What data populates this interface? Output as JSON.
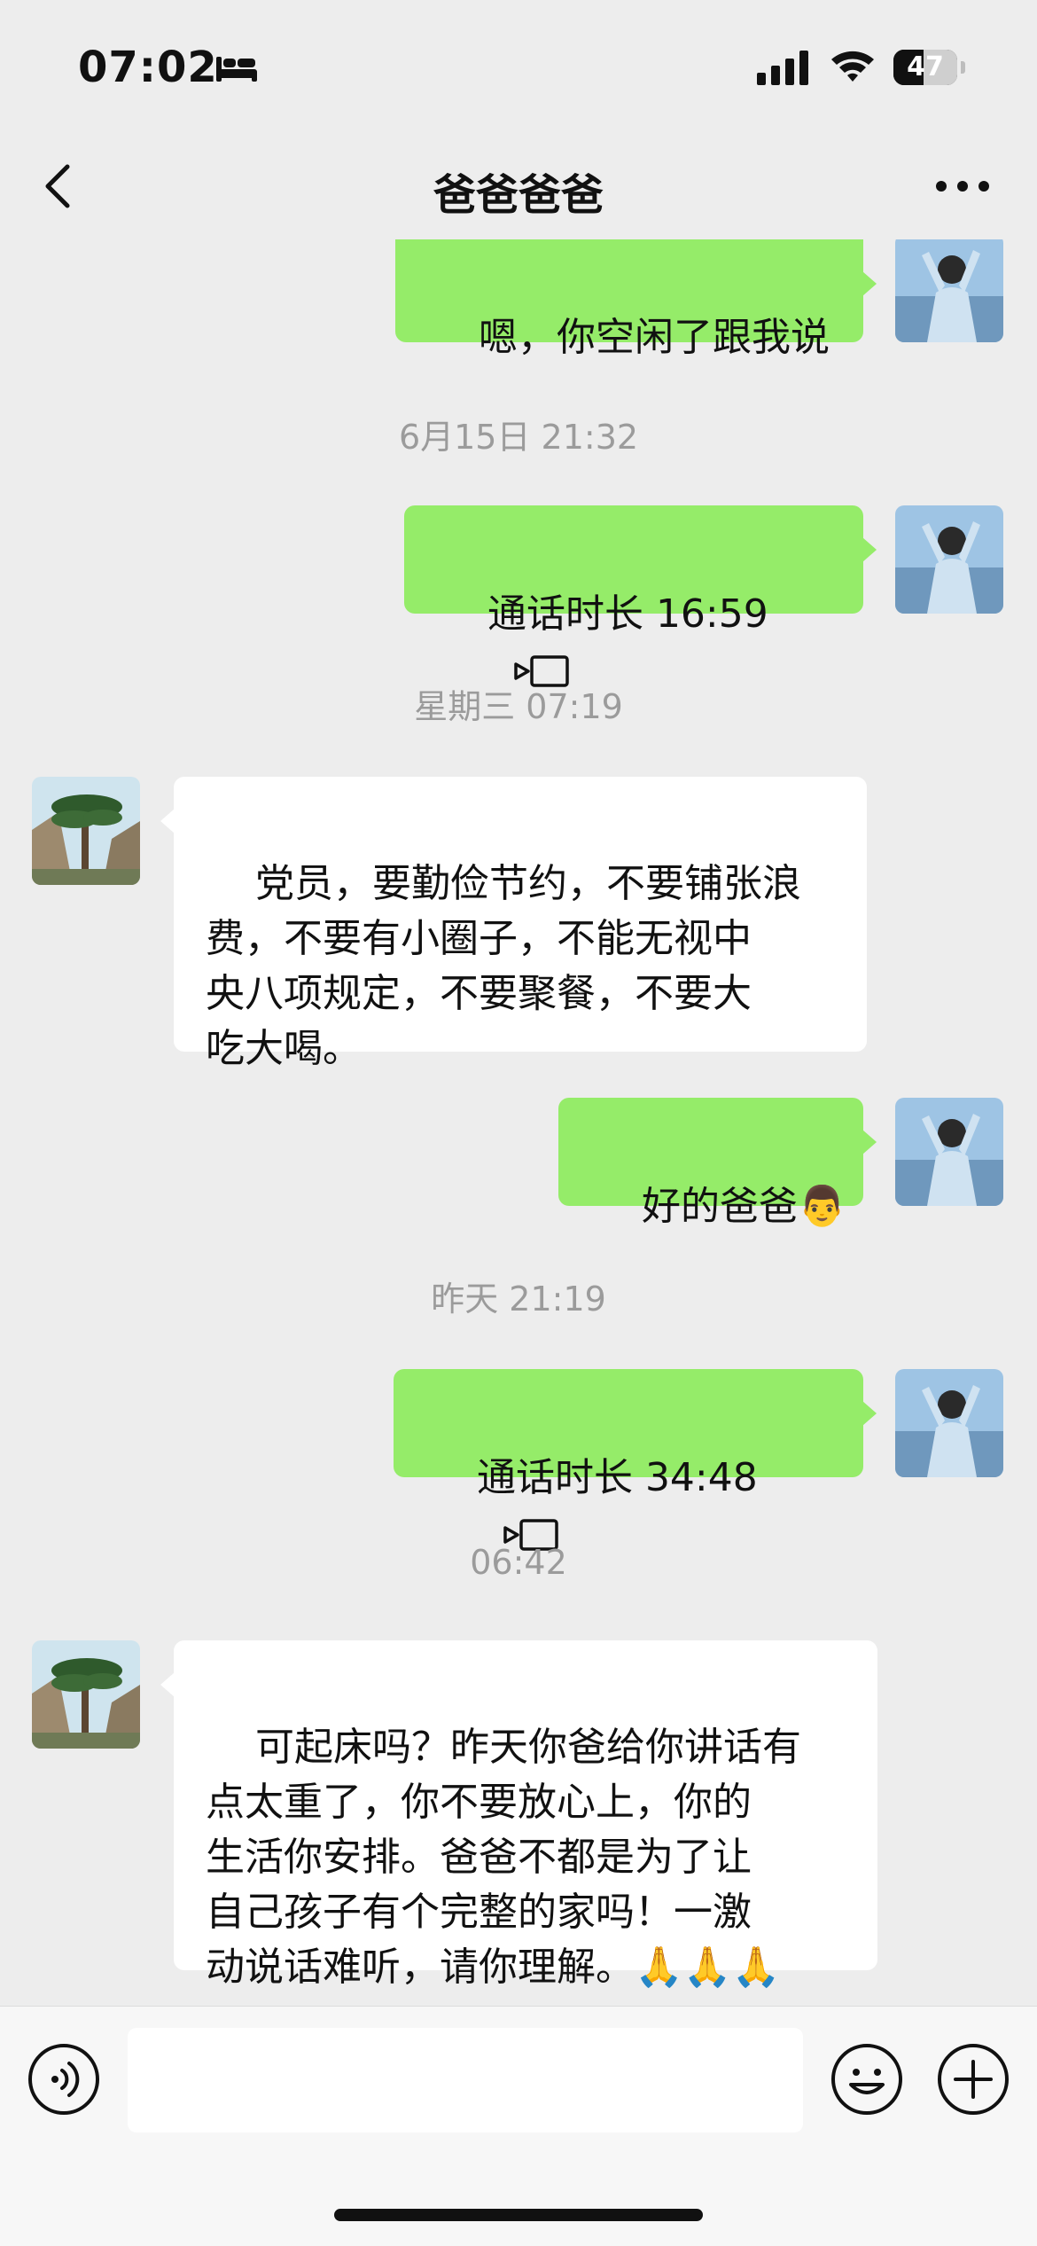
{
  "status_bar": {
    "time": "07:02",
    "battery": "47",
    "battery_level": 0.47
  },
  "header": {
    "title": "爸爸爸爸"
  },
  "messages": {
    "m1": "嗯，你空闲了跟我说",
    "t1": "6月15日 21:32",
    "m2": "通话时长 16:59",
    "t2": "星期三 07:19",
    "m3": "党员，要勤俭节约，不要铺张浪\n费，不要有小圈子，不能无视中\n央八项规定，不要聚餐，不要大\n吃大喝。",
    "m4": "好的爸爸👨",
    "t3": "昨天 21:19",
    "m5": "通话时长 34:48",
    "t4": "06:42",
    "m6": "可起床吗？昨天你爸给你讲话有\n点太重了，你不要放心上，你的\n生活你安排。爸爸不都是为了让\n自己孩子有个完整的家吗！一激\n动说话难听，请你理解。🙏🙏🙏"
  },
  "input": {
    "value": ""
  },
  "colors": {
    "background": "#ededed",
    "my_bubble": "#95ec69",
    "other_bubble": "#ffffff",
    "timestamp": "#9b9b9b"
  },
  "icons": {
    "sleep_focus": "bed-icon",
    "signal": "signal-icon",
    "wifi": "wifi-icon",
    "back": "chevron-left-icon",
    "more": "more-icon",
    "call": "video-call-icon",
    "voice": "voice-icon",
    "emoji": "emoji-icon",
    "plus": "plus-icon"
  }
}
